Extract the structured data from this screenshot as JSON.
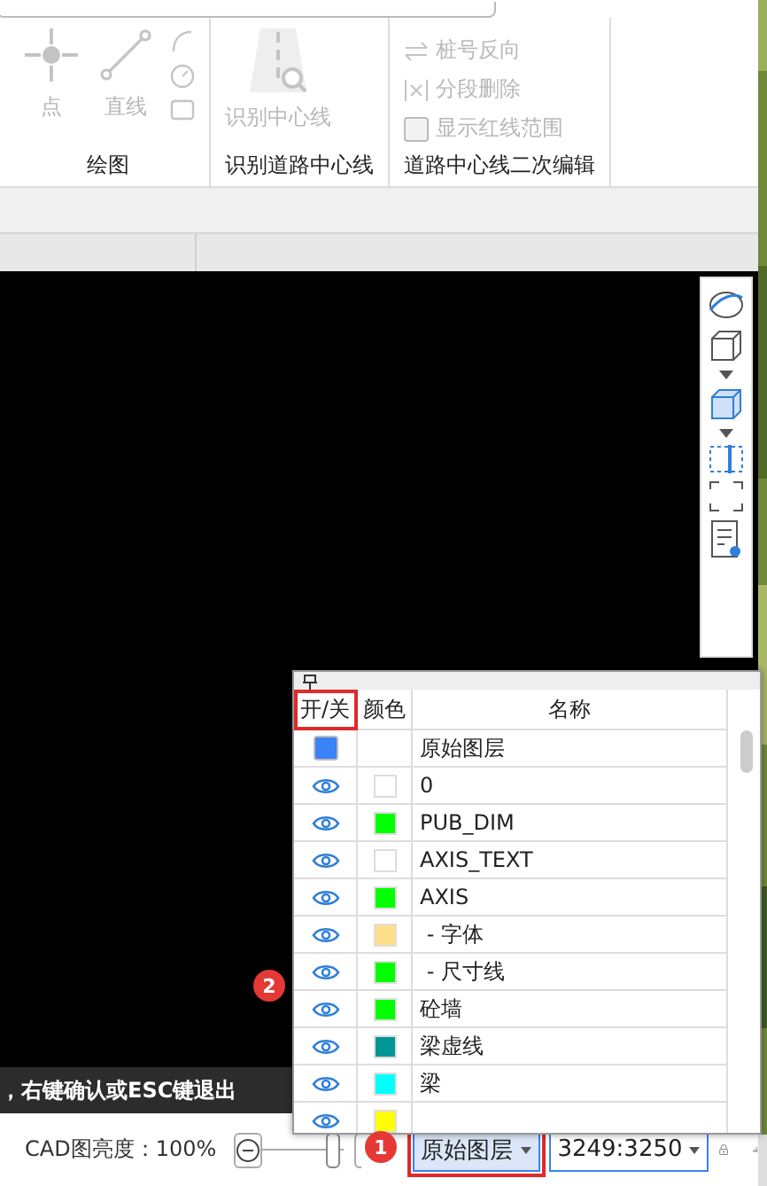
{
  "ribbon": {
    "groups": [
      {
        "label": "绘图",
        "tools": [
          {
            "kind": "point",
            "label": "点",
            "disabled": true
          },
          {
            "kind": "line",
            "label": "直线",
            "disabled": true
          },
          {
            "kind": "small-stack",
            "disabled": true
          }
        ]
      },
      {
        "label": "识别道路中心线",
        "tools": [
          {
            "kind": "road",
            "label": "识别中心线",
            "disabled": true
          }
        ]
      },
      {
        "label": "道路中心线二次编辑",
        "tools": [
          {
            "kind": "list",
            "disabled": true,
            "items": [
              {
                "kind": "action",
                "label": "桩号反向"
              },
              {
                "kind": "action",
                "label": "分段删除"
              },
              {
                "kind": "checkbox",
                "label": "显示红线范围",
                "checked": false
              }
            ]
          }
        ]
      }
    ]
  },
  "command_hint": "，右键确认或ESC键退出",
  "layer_panel": {
    "columns": [
      "开/关",
      "颜色",
      "名称"
    ],
    "callout": "2",
    "rows": [
      {
        "kind": "group",
        "name": "原始图层",
        "checked": true
      },
      {
        "kind": "layer",
        "name": "0",
        "color": "#ffffff"
      },
      {
        "kind": "layer",
        "name": "PUB_DIM",
        "color": "#00ff00"
      },
      {
        "kind": "layer",
        "name": "AXIS_TEXT",
        "color": "#ffffff"
      },
      {
        "kind": "layer",
        "name": "AXIS",
        "color": "#00ff00"
      },
      {
        "kind": "layer",
        "name": " - 字体",
        "color": "#ffde8a"
      },
      {
        "kind": "layer",
        "name": " - 尺寸线",
        "color": "#00ff00"
      },
      {
        "kind": "layer",
        "name": "砼墙",
        "color": "#00ff00"
      },
      {
        "kind": "layer",
        "name": "梁虚线",
        "color": "#009696"
      },
      {
        "kind": "layer",
        "name": "梁",
        "color": "#00ffff"
      },
      {
        "kind": "layer",
        "color": "#ffff00"
      }
    ]
  },
  "status_bar": {
    "brightness": "CAD图亮度：100%",
    "level": 0.95,
    "callout": "1",
    "layer_select": "原始图层",
    "scale_select": "3249:3250"
  }
}
